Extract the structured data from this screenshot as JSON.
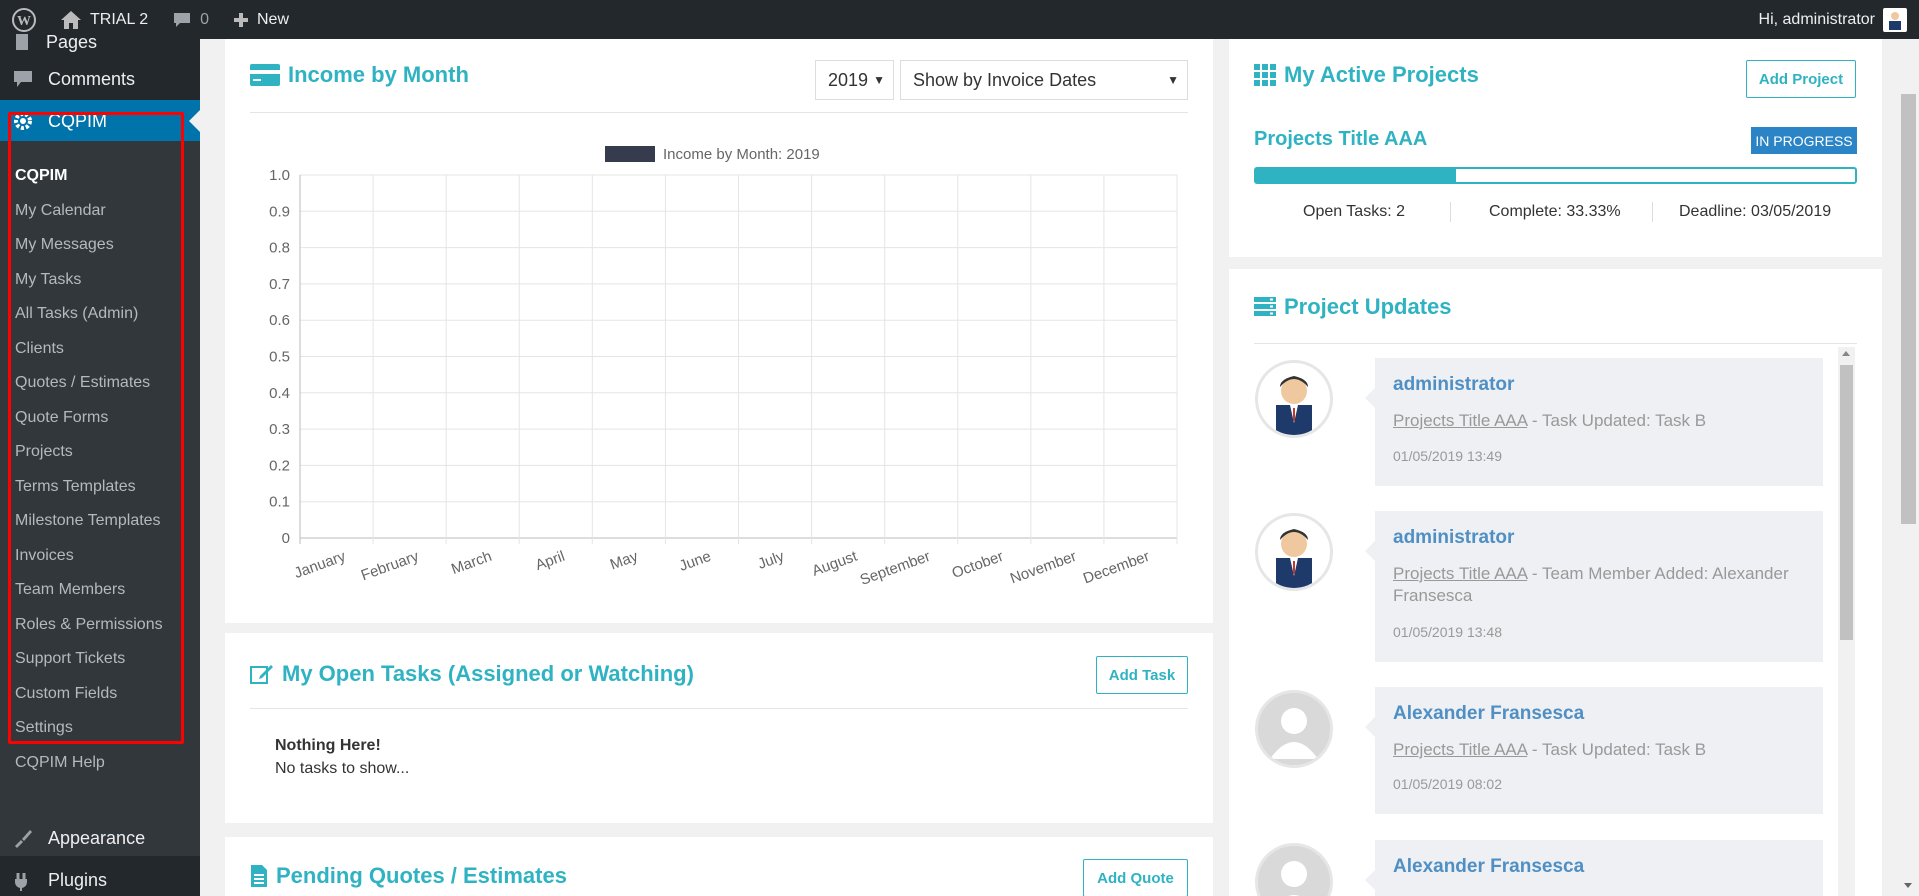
{
  "adminbar": {
    "site_name": "TRIAL 2",
    "comments_count": "0",
    "new_label": "New",
    "greeting": "Hi, administrator"
  },
  "sidebar": {
    "pages_label": "Pages",
    "comments_label": "Comments",
    "cqpim_label": "CQPIM",
    "submenu": [
      "CQPIM",
      "My Calendar",
      "My Messages",
      "My Tasks",
      "All Tasks (Admin)",
      "Clients",
      "Quotes / Estimates",
      "Quote Forms",
      "Projects",
      "Terms Templates",
      "Milestone Templates",
      "Invoices",
      "Team Members",
      "Roles & Permissions",
      "Support Tickets",
      "Custom Fields",
      "Settings",
      "CQPIM Help"
    ],
    "appearance_label": "Appearance",
    "plugins_label": "Plugins"
  },
  "income": {
    "title": "Income by Month",
    "year": "2019",
    "show_by": "Show by Invoice Dates"
  },
  "chart_data": {
    "type": "bar",
    "title": "",
    "legend": "Income by Month: 2019",
    "categories": [
      "January",
      "February",
      "March",
      "April",
      "May",
      "June",
      "July",
      "August",
      "September",
      "October",
      "November",
      "December"
    ],
    "series": [
      {
        "name": "Income by Month: 2019",
        "values": [
          0,
          0,
          0,
          0,
          0,
          0,
          0,
          0,
          0,
          0,
          0,
          0
        ]
      }
    ],
    "ylim": [
      0,
      1.0
    ],
    "yticks": [
      "1.0",
      "0.9",
      "0.8",
      "0.7",
      "0.6",
      "0.5",
      "0.4",
      "0.3",
      "0.2",
      "0.1",
      "0"
    ],
    "grid": true,
    "legend_position": "top",
    "series_color": "#363b4e"
  },
  "tasks": {
    "title": "My Open Tasks (Assigned or Watching)",
    "add_label": "Add Task",
    "empty_title": "Nothing Here!",
    "empty_sub": "No tasks to show..."
  },
  "quotes": {
    "title": "Pending Quotes / Estimates",
    "add_label": "Add Quote"
  },
  "projects": {
    "title": "My Active Projects",
    "add_label": "Add Project",
    "project_name": "Projects Title AAA",
    "status": "IN PROGRESS",
    "progress_fraction": 0.3333,
    "open_tasks": "Open Tasks: 2",
    "complete": "Complete: 33.33%",
    "deadline": "Deadline: 03/05/2019"
  },
  "updates": {
    "title": "Project Updates",
    "items": [
      {
        "user": "administrator",
        "project": "Projects Title AAA",
        "message": " - Task Updated: Task B",
        "time": "01/05/2019 13:49"
      },
      {
        "user": "administrator",
        "project": "Projects Title AAA",
        "message": " - Team Member Added: Alexander Fransesca",
        "time": "01/05/2019 13:48"
      },
      {
        "user": "Alexander Fransesca",
        "project": "Projects Title AAA",
        "message": " - Task Updated: Task B",
        "time": "01/05/2019 08:02"
      },
      {
        "user": "Alexander Fransesca"
      }
    ]
  },
  "colors": {
    "accent": "#2fb3c2",
    "admin_blue": "#0073aa",
    "status_blue": "#2a84c6"
  }
}
